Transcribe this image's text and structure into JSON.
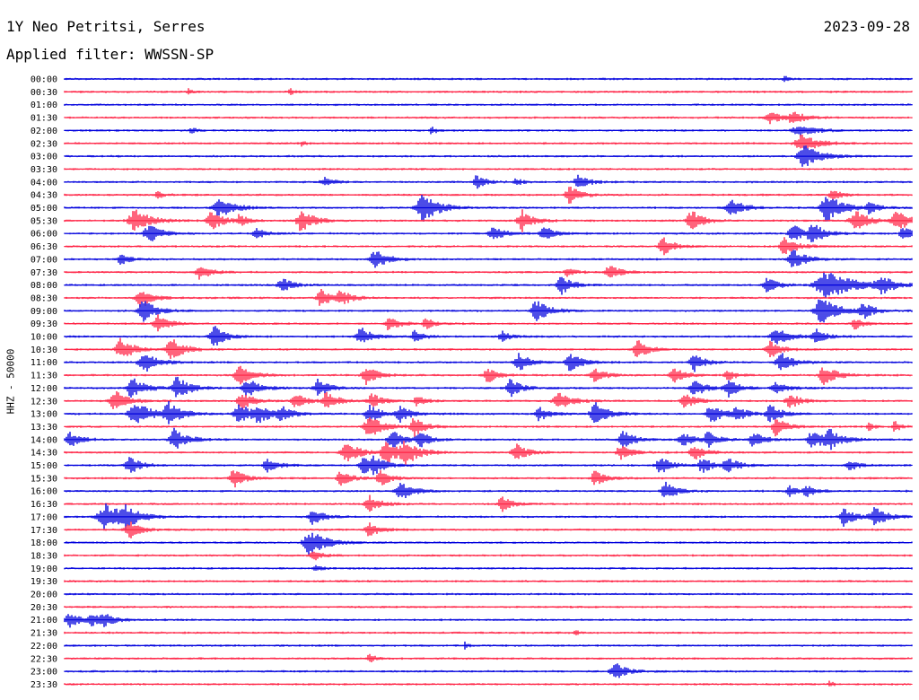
{
  "header": {
    "station": "1Y Neo Petritsi, Serres",
    "date": "2023-09-28",
    "filter": "Applied filter: WWSSN-SP"
  },
  "channel_label": "HHZ - 50000",
  "colors": {
    "trace_a": "#0000dd",
    "trace_b": "#ff2244",
    "text": "#000000",
    "background": "#ffffff"
  },
  "chart_data": {
    "type": "line",
    "title": "",
    "xlabel": "",
    "ylabel": "HHZ - 50000",
    "row_labels": [
      "00:00",
      "00:30",
      "01:00",
      "01:30",
      "02:00",
      "02:30",
      "03:00",
      "03:30",
      "04:00",
      "04:30",
      "05:00",
      "05:30",
      "06:00",
      "06:30",
      "07:00",
      "07:30",
      "08:00",
      "08:30",
      "09:00",
      "09:30",
      "10:00",
      "10:30",
      "11:00",
      "11:30",
      "12:00",
      "12:30",
      "13:00",
      "13:30",
      "14:00",
      "14:30",
      "15:00",
      "15:30",
      "16:00",
      "16:30",
      "17:00",
      "17:30",
      "18:00",
      "18:30",
      "19:00",
      "19:30",
      "20:00",
      "20:30",
      "21:00",
      "21:30",
      "22:00",
      "22:30",
      "23:00",
      "23:30"
    ],
    "minutes_per_row": 30,
    "trace_colors": [
      "#0000dd",
      "#ff2244"
    ],
    "grid": false,
    "events": [
      [
        0,
        25.5,
        3,
        0.4
      ],
      [
        1,
        4.4,
        3,
        0.4
      ],
      [
        1,
        8.0,
        3,
        0.4
      ],
      [
        3,
        25.0,
        6,
        1.2
      ],
      [
        3,
        25.8,
        6,
        1.2
      ],
      [
        4,
        4.5,
        3,
        0.5
      ],
      [
        4,
        13.0,
        4,
        0.5
      ],
      [
        4,
        26.0,
        6,
        1.5
      ],
      [
        5,
        8.4,
        3,
        0.3
      ],
      [
        5,
        26.1,
        10,
        1.5
      ],
      [
        6,
        26.2,
        12,
        1.5
      ],
      [
        8,
        9.2,
        5,
        0.8
      ],
      [
        8,
        14.6,
        8,
        0.8
      ],
      [
        8,
        16.0,
        4,
        0.6
      ],
      [
        8,
        18.2,
        7,
        1.0
      ],
      [
        9,
        3.3,
        4,
        0.6
      ],
      [
        9,
        17.9,
        10,
        1.0
      ],
      [
        9,
        27.2,
        6,
        0.8
      ],
      [
        10,
        5.5,
        10,
        1.5
      ],
      [
        10,
        12.7,
        15,
        1.5
      ],
      [
        10,
        23.6,
        10,
        1.2
      ],
      [
        10,
        27.0,
        15,
        1.5
      ],
      [
        10,
        28.5,
        6,
        0.8
      ],
      [
        11,
        2.5,
        12,
        1.5
      ],
      [
        11,
        5.2,
        12,
        1.0
      ],
      [
        11,
        6.2,
        6,
        0.8
      ],
      [
        11,
        8.4,
        12,
        1.2
      ],
      [
        11,
        16.2,
        12,
        1.0
      ],
      [
        11,
        22.2,
        12,
        1.0
      ],
      [
        11,
        28.0,
        12,
        1.2
      ],
      [
        11,
        29.5,
        12,
        1.2
      ],
      [
        12,
        3.0,
        10,
        1.2
      ],
      [
        12,
        6.8,
        7,
        0.8
      ],
      [
        12,
        15.2,
        8,
        1.0
      ],
      [
        12,
        17.0,
        8,
        1.0
      ],
      [
        12,
        25.8,
        10,
        1.0
      ],
      [
        12,
        26.5,
        10,
        1.2
      ],
      [
        12,
        29.7,
        8,
        0.8
      ],
      [
        13,
        21.2,
        10,
        1.0
      ],
      [
        13,
        25.5,
        10,
        1.2
      ],
      [
        14,
        2.0,
        6,
        0.8
      ],
      [
        14,
        11.0,
        10,
        1.2
      ],
      [
        14,
        25.8,
        12,
        1.2
      ],
      [
        15,
        4.8,
        8,
        1.0
      ],
      [
        15,
        17.8,
        5,
        0.8
      ],
      [
        15,
        19.3,
        8,
        1.0
      ],
      [
        16,
        7.7,
        8,
        1.0
      ],
      [
        16,
        17.6,
        10,
        1.0
      ],
      [
        16,
        24.9,
        8,
        1.0
      ],
      [
        16,
        27.0,
        15,
        2.5
      ],
      [
        16,
        28.9,
        10,
        1.2
      ],
      [
        17,
        2.7,
        12,
        1.0
      ],
      [
        17,
        9.1,
        10,
        1.0
      ],
      [
        17,
        9.8,
        8,
        1.0
      ],
      [
        18,
        2.8,
        12,
        1.2
      ],
      [
        18,
        16.7,
        12,
        1.2
      ],
      [
        18,
        26.8,
        15,
        1.5
      ],
      [
        18,
        28.3,
        8,
        1.0
      ],
      [
        19,
        3.3,
        10,
        1.0
      ],
      [
        19,
        11.5,
        8,
        1.0
      ],
      [
        19,
        12.8,
        6,
        0.8
      ],
      [
        19,
        28.0,
        6,
        0.8
      ],
      [
        20,
        5.3,
        12,
        1.0
      ],
      [
        20,
        10.5,
        10,
        1.0
      ],
      [
        20,
        12.4,
        6,
        0.8
      ],
      [
        20,
        15.5,
        6,
        0.8
      ],
      [
        20,
        25.2,
        10,
        1.2
      ],
      [
        20,
        26.6,
        8,
        1.0
      ],
      [
        21,
        2.0,
        12,
        1.2
      ],
      [
        21,
        3.8,
        12,
        1.2
      ],
      [
        21,
        20.3,
        10,
        1.0
      ],
      [
        21,
        25.0,
        10,
        1.0
      ],
      [
        22,
        2.8,
        12,
        1.2
      ],
      [
        22,
        16.1,
        10,
        1.0
      ],
      [
        22,
        17.9,
        10,
        1.2
      ],
      [
        22,
        22.3,
        10,
        1.0
      ],
      [
        22,
        25.4,
        10,
        1.2
      ],
      [
        23,
        6.2,
        10,
        1.2
      ],
      [
        23,
        10.7,
        10,
        1.0
      ],
      [
        23,
        15.0,
        8,
        1.0
      ],
      [
        23,
        18.8,
        8,
        1.0
      ],
      [
        23,
        21.6,
        8,
        1.0
      ],
      [
        23,
        23.5,
        6,
        0.8
      ],
      [
        23,
        26.9,
        10,
        1.2
      ],
      [
        24,
        2.4,
        12,
        1.2
      ],
      [
        24,
        4.0,
        12,
        1.2
      ],
      [
        24,
        6.5,
        10,
        1.2
      ],
      [
        24,
        9.0,
        10,
        1.0
      ],
      [
        24,
        15.8,
        10,
        1.0
      ],
      [
        24,
        22.3,
        10,
        1.0
      ],
      [
        24,
        23.5,
        10,
        1.0
      ],
      [
        24,
        25.2,
        8,
        1.0
      ],
      [
        25,
        1.8,
        12,
        1.2
      ],
      [
        25,
        6.3,
        10,
        1.0
      ],
      [
        25,
        8.2,
        8,
        1.0
      ],
      [
        25,
        9.3,
        10,
        1.0
      ],
      [
        25,
        10.9,
        8,
        1.0
      ],
      [
        25,
        12.5,
        6,
        0.8
      ],
      [
        25,
        17.5,
        10,
        1.2
      ],
      [
        25,
        22.0,
        8,
        1.0
      ],
      [
        25,
        25.7,
        8,
        1.0
      ],
      [
        26,
        2.5,
        14,
        1.5
      ],
      [
        26,
        3.7,
        12,
        1.2
      ],
      [
        26,
        6.2,
        12,
        1.2
      ],
      [
        26,
        6.9,
        10,
        1.0
      ],
      [
        26,
        7.7,
        8,
        1.0
      ],
      [
        26,
        10.8,
        10,
        1.0
      ],
      [
        26,
        11.9,
        10,
        1.0
      ],
      [
        26,
        16.8,
        8,
        1.0
      ],
      [
        26,
        18.8,
        12,
        1.2
      ],
      [
        26,
        22.9,
        10,
        1.2
      ],
      [
        26,
        23.8,
        8,
        1.0
      ],
      [
        26,
        25.0,
        10,
        1.0
      ],
      [
        27,
        10.8,
        12,
        1.2
      ],
      [
        27,
        12.4,
        10,
        1.0
      ],
      [
        27,
        25.2,
        10,
        1.0
      ],
      [
        27,
        28.5,
        4,
        0.5
      ],
      [
        27,
        29.4,
        6,
        0.6
      ],
      [
        28,
        0.2,
        8,
        1.0
      ],
      [
        28,
        3.9,
        12,
        1.2
      ],
      [
        28,
        11.6,
        10,
        1.0
      ],
      [
        28,
        12.6,
        8,
        1.0
      ],
      [
        28,
        19.8,
        10,
        1.0
      ],
      [
        28,
        21.9,
        8,
        1.0
      ],
      [
        28,
        22.8,
        8,
        1.0
      ],
      [
        28,
        24.4,
        8,
        1.0
      ],
      [
        28,
        26.5,
        10,
        1.2
      ],
      [
        28,
        27.1,
        10,
        1.2
      ],
      [
        29,
        10.0,
        12,
        1.2
      ],
      [
        29,
        11.4,
        12,
        1.2
      ],
      [
        29,
        12.1,
        12,
        1.2
      ],
      [
        29,
        16.0,
        10,
        1.0
      ],
      [
        29,
        19.7,
        8,
        1.0
      ],
      [
        29,
        22.3,
        8,
        1.0
      ],
      [
        30,
        2.3,
        10,
        1.0
      ],
      [
        30,
        7.2,
        8,
        1.0
      ],
      [
        30,
        10.6,
        10,
        1.0
      ],
      [
        30,
        11.0,
        8,
        1.0
      ],
      [
        30,
        21.1,
        10,
        1.0
      ],
      [
        30,
        22.6,
        8,
        1.0
      ],
      [
        30,
        23.5,
        8,
        1.0
      ],
      [
        30,
        27.8,
        6,
        0.8
      ],
      [
        31,
        6.0,
        10,
        1.0
      ],
      [
        31,
        9.8,
        8,
        1.0
      ],
      [
        31,
        11.2,
        8,
        1.0
      ],
      [
        31,
        18.8,
        8,
        1.0
      ],
      [
        32,
        11.9,
        10,
        1.2
      ],
      [
        32,
        21.3,
        10,
        1.0
      ],
      [
        32,
        25.7,
        6,
        0.8
      ],
      [
        32,
        26.3,
        6,
        0.8
      ],
      [
        33,
        10.8,
        10,
        1.0
      ],
      [
        33,
        15.5,
        8,
        1.0
      ],
      [
        34,
        1.5,
        14,
        2.0
      ],
      [
        34,
        2.2,
        8,
        1.0
      ],
      [
        34,
        8.8,
        10,
        1.0
      ],
      [
        34,
        27.6,
        10,
        1.0
      ],
      [
        34,
        28.7,
        10,
        1.2
      ],
      [
        35,
        2.3,
        10,
        1.0
      ],
      [
        35,
        10.8,
        8,
        1.0
      ],
      [
        36,
        8.7,
        14,
        1.5
      ],
      [
        37,
        8.8,
        6,
        0.8
      ],
      [
        38,
        8.9,
        4,
        0.5
      ],
      [
        42,
        0.2,
        8,
        1.0
      ],
      [
        42,
        1.0,
        6,
        1.0
      ],
      [
        42,
        1.4,
        6,
        1.0
      ],
      [
        43,
        18.1,
        3,
        0.3
      ],
      [
        44,
        14.2,
        4,
        0.3
      ],
      [
        45,
        10.8,
        5,
        0.5
      ],
      [
        46,
        19.5,
        10,
        1.0
      ],
      [
        47,
        27.1,
        4,
        0.3
      ]
    ]
  }
}
